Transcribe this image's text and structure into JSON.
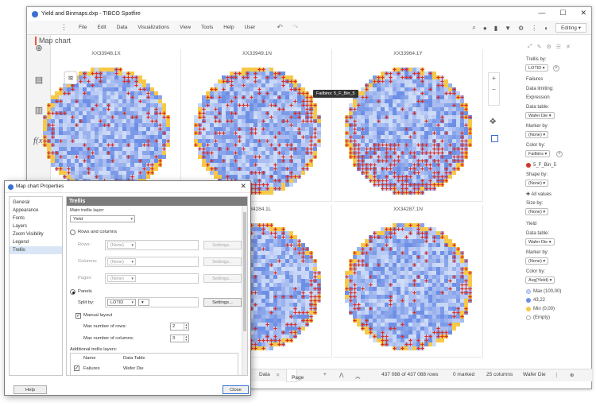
{
  "window": {
    "title": "Yield and Binmaps.dxp - TIBCO Spotfire",
    "minimize": "—",
    "maximize": "☐",
    "close": "✕"
  },
  "menu": {
    "dots": "⋮",
    "items": [
      "File",
      "Edit",
      "Data",
      "Visualizations",
      "View",
      "Tools",
      "Help",
      "User"
    ],
    "undo": "↶",
    "redo": "↷",
    "right_icons": [
      "search-icon",
      "comments-icon",
      "bookmark-icon",
      "filter-icon",
      "gear-icon",
      "more-icon",
      "notifications-icon"
    ],
    "mode": "Editing",
    "mode_arrow": "▾"
  },
  "rail": {
    "icons": [
      "add-icon",
      "data-table-icon",
      "bar-chart-icon",
      "expression-icon"
    ]
  },
  "viz": {
    "title": "Map chart",
    "tooltip": "Failbins: 5_F_Bin_5",
    "panels": [
      {
        "title": "XX33948.1X"
      },
      {
        "title": "XX33949.1N"
      },
      {
        "title": "XX33964.1Y"
      },
      {
        "title": ""
      },
      {
        "title": "XX34284.1L"
      },
      {
        "title": "XX34287.1N"
      }
    ],
    "zoom_in": "+",
    "zoom_out": "−"
  },
  "legend": {
    "trellis_by": "Trellis by:",
    "trellis_value": "LOTID",
    "layer1": "Failures",
    "data_limiting": "Data limiting:",
    "expression": "Expression",
    "data_table": "Data table:",
    "data_table_value": "Wafer Die",
    "marker_by": "Marker by:",
    "none": "(None)",
    "color_by": "Color by:",
    "color_value": "Failbins",
    "bin_item": "5_F_Bin_5",
    "shape_by": "Shape by:",
    "all_values": "All values",
    "size_by": "Size by:",
    "layer2": "Yield",
    "color_value2": "Avg(Yield)",
    "max": "Max (100,00)",
    "mid": "43,22",
    "min": "Min (0,00)",
    "empty": "(Empty)",
    "colors": {
      "fail": "#d8322a",
      "max": "#c7d6f7",
      "mid": "#6d8fe6",
      "min": "#f7c948",
      "empty": "#ffffff"
    }
  },
  "bottombar": {
    "tab_data": "Data",
    "tab_page": "Page",
    "rows": "437 088 of 437 088 rows",
    "marked": "0 marked",
    "columns": "25 columns",
    "table": "Wafer Die"
  },
  "dialog": {
    "title": "Map chart Properties",
    "close_x": "✕",
    "nav": [
      "General",
      "Appearance",
      "Fonts",
      "Layers",
      "Zoom Visibility",
      "Legend",
      "Trellis"
    ],
    "selected_nav": "Trellis",
    "header": "Trellis",
    "main_layer_label": "Main trellis layer:",
    "main_layer_value": "Yield",
    "rows_and_columns": "Rows and columns",
    "rows": "Rows:",
    "columns": "Columns:",
    "pages": "Pages:",
    "none": "(None)",
    "settings": "Settings...",
    "panels": "Panels",
    "split_by": "Split by:",
    "split_value": "LOTID",
    "manual_layout": "Manual layout",
    "max_rows_label": "Max number of rows:",
    "max_rows": "2",
    "max_cols_label": "Max number of columns:",
    "max_cols": "3",
    "additional_layers": "Additional trellis layers:",
    "col_name": "Name",
    "col_table": "Data Table",
    "layer_name": "Failures",
    "layer_table": "Wafer Die",
    "help": "Help",
    "close": "Close"
  }
}
